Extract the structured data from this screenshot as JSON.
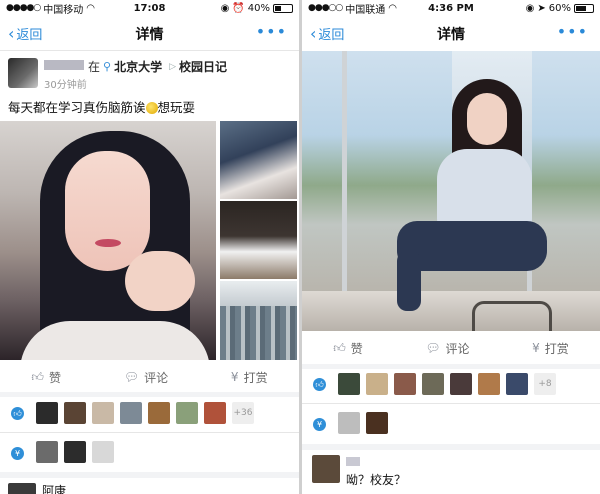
{
  "phone1": {
    "status": {
      "carrier": "中国移动",
      "time": "17:08",
      "battery": "40%",
      "battery_level": 0.4
    },
    "nav": {
      "back": "返回",
      "title": "详情"
    },
    "post": {
      "location_prefix": "在",
      "location": "北京大学",
      "topic": "校园日记",
      "time": "30分钟前",
      "caption": "每天都在学习真伤脑筋诶",
      "caption_tail": "想玩耍"
    },
    "actions": {
      "like": "赞",
      "comment": "评论",
      "reward": "打赏"
    },
    "likes_more": "+36",
    "like_colors": [
      "#2b2b2b",
      "#5a4434",
      "#c9b9a6",
      "#7d8a96",
      "#9a6a3a",
      "#8aa07a",
      "#b0523a"
    ],
    "reward_colors": [
      "#6b6b6b",
      "#2c2c2c",
      "#d8d8d8"
    ],
    "bottom_text": "阿康"
  },
  "phone2": {
    "status": {
      "carrier": "中国联通",
      "time": "4:36 PM",
      "battery": "60%",
      "battery_level": 0.6
    },
    "nav": {
      "back": "返回",
      "title": "详情"
    },
    "actions": {
      "like": "赞",
      "comment": "评论",
      "reward": "打赏"
    },
    "likes_more": "+8",
    "like_colors": [
      "#3b4a3a",
      "#c9b08a",
      "#8a5a4a",
      "#6d6a58",
      "#4a3a3a",
      "#b07a4a",
      "#3a4a6a"
    ],
    "reward_colors": [
      "#bdbdbd",
      "#4a3020"
    ],
    "comment": {
      "text": "呦？校友？",
      "avatar_color": "#5b4a3a"
    }
  }
}
